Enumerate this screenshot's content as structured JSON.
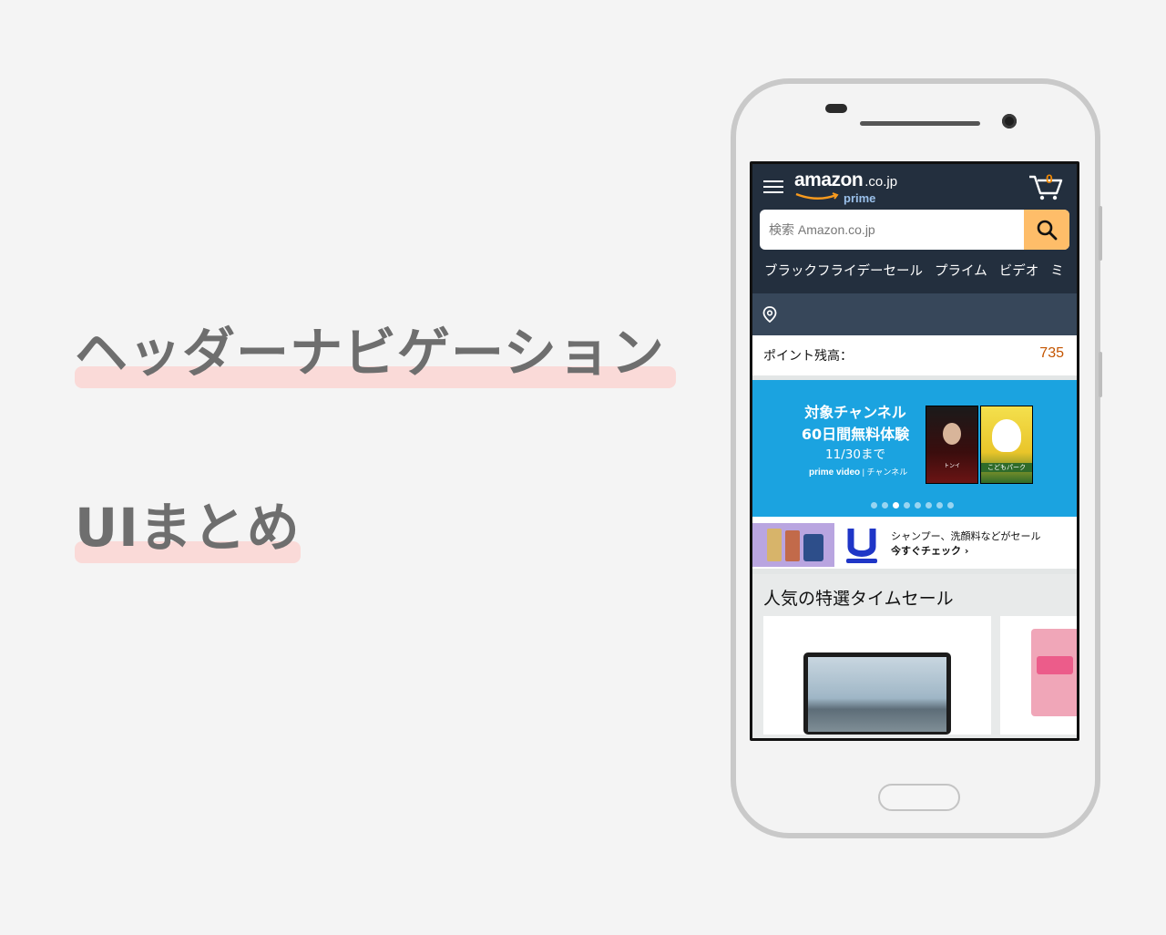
{
  "headline": {
    "line1": "ヘッダーナビゲーション",
    "line2": "UIまとめ"
  },
  "phone_screen": {
    "header": {
      "logo_word": "amazon",
      "logo_tld": ".co.jp",
      "logo_sub": "prime",
      "cart_count": "0",
      "search_placeholder": "検索 Amazon.co.jp",
      "nav_items": [
        "ブラックフライデーセール",
        "プライム",
        "ビデオ",
        "ミ"
      ]
    },
    "points": {
      "label": "ポイント残高：",
      "value": "735"
    },
    "banner": {
      "line1": "対象チャンネル",
      "line2": "60日間無料体験",
      "line3": "11/30まで",
      "brand_main": "prime video",
      "brand_sub": "| チャンネル",
      "poster1_caption": "トンイ",
      "poster2_caption": "こどもパーク",
      "dots_total": 8,
      "dots_active_index": 2
    },
    "ad": {
      "line1": "シャンプー、洗顔料などがセール",
      "line2": "今すぐチェック ›"
    },
    "deals": {
      "title": "人気の特選タイムセール"
    }
  },
  "colors": {
    "header_bg": "#232f3e",
    "location_bar_bg": "#37475a",
    "search_button": "#febd69",
    "points_value": "#c45500",
    "banner_bg": "#1ba3e0",
    "highlight": "#fadad8"
  },
  "icons": [
    "menu-icon",
    "cart-icon",
    "search-icon",
    "location-pin-icon",
    "unilever-logo"
  ]
}
